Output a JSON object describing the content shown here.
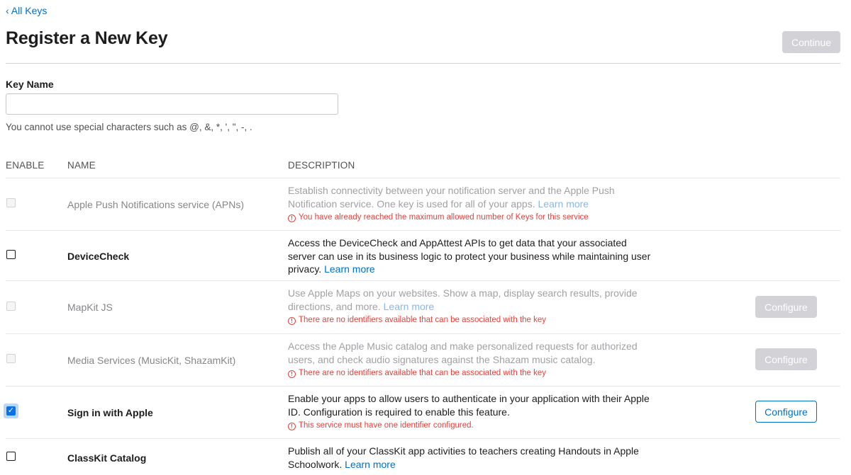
{
  "nav": {
    "back_label": "All Keys"
  },
  "header": {
    "title": "Register a New Key",
    "continue_label": "Continue"
  },
  "key_field": {
    "label": "Key Name",
    "value": "",
    "placeholder": "",
    "hint": "You cannot use special characters such as @, &, *, ', \", -, ."
  },
  "table": {
    "columns": {
      "enable": "ENABLE",
      "name": "NAME",
      "description": "DESCRIPTION"
    },
    "rows": [
      {
        "name": "Apple Push Notifications service (APNs)",
        "description": "Establish connectivity between your notification server and the Apple Push Notification service. One key is used for all of your apps.",
        "learn_more": "Learn more",
        "warning": "You have already reached the maximum allowed number of Keys for this service",
        "state": "disabled",
        "checked": false,
        "configure_label": ""
      },
      {
        "name": "DeviceCheck",
        "description": "Access the DeviceCheck and AppAttest APIs to get data that your associated server can use in its business logic to protect your business while maintaining user privacy.",
        "learn_more": "Learn more",
        "warning": "",
        "state": "enabled",
        "checked": false,
        "configure_label": ""
      },
      {
        "name": "MapKit JS",
        "description": "Use Apple Maps on your websites. Show a map, display search results, provide directions, and more.",
        "learn_more": "Learn more",
        "warning": "There are no identifiers available that can be associated with the key",
        "state": "disabled",
        "checked": false,
        "configure_label": "Configure"
      },
      {
        "name": "Media Services (MusicKit, ShazamKit)",
        "description": "Access the Apple Music catalog and make personalized requests for authorized users, and check audio signatures against the Shazam music catalog.",
        "learn_more": "",
        "warning": "There are no identifiers available that can be associated with the key",
        "state": "disabled",
        "checked": false,
        "configure_label": "Configure"
      },
      {
        "name": "Sign in with Apple",
        "description": "Enable your apps to allow users to authenticate in your application with their Apple ID. Configuration is required to enable this feature.",
        "learn_more": "",
        "warning": "This service must have one identifier configured.",
        "state": "enabled",
        "checked": true,
        "configure_label": "Configure"
      },
      {
        "name": "ClassKit Catalog",
        "description": "Publish all of your ClassKit app activities to teachers creating Handouts in Apple Schoolwork.",
        "learn_more": "Learn more",
        "warning": "",
        "state": "enabled",
        "checked": false,
        "configure_label": ""
      }
    ]
  },
  "icons": {
    "back": "chevron-left-icon",
    "warning": "exclamation-circle-icon",
    "checkmark": "checkmark-icon"
  },
  "colors": {
    "link": "#0070c9",
    "warning": "#e0443e",
    "disabled_button": "#d2d2d7",
    "checkbox_checked": "#0a72e6"
  }
}
